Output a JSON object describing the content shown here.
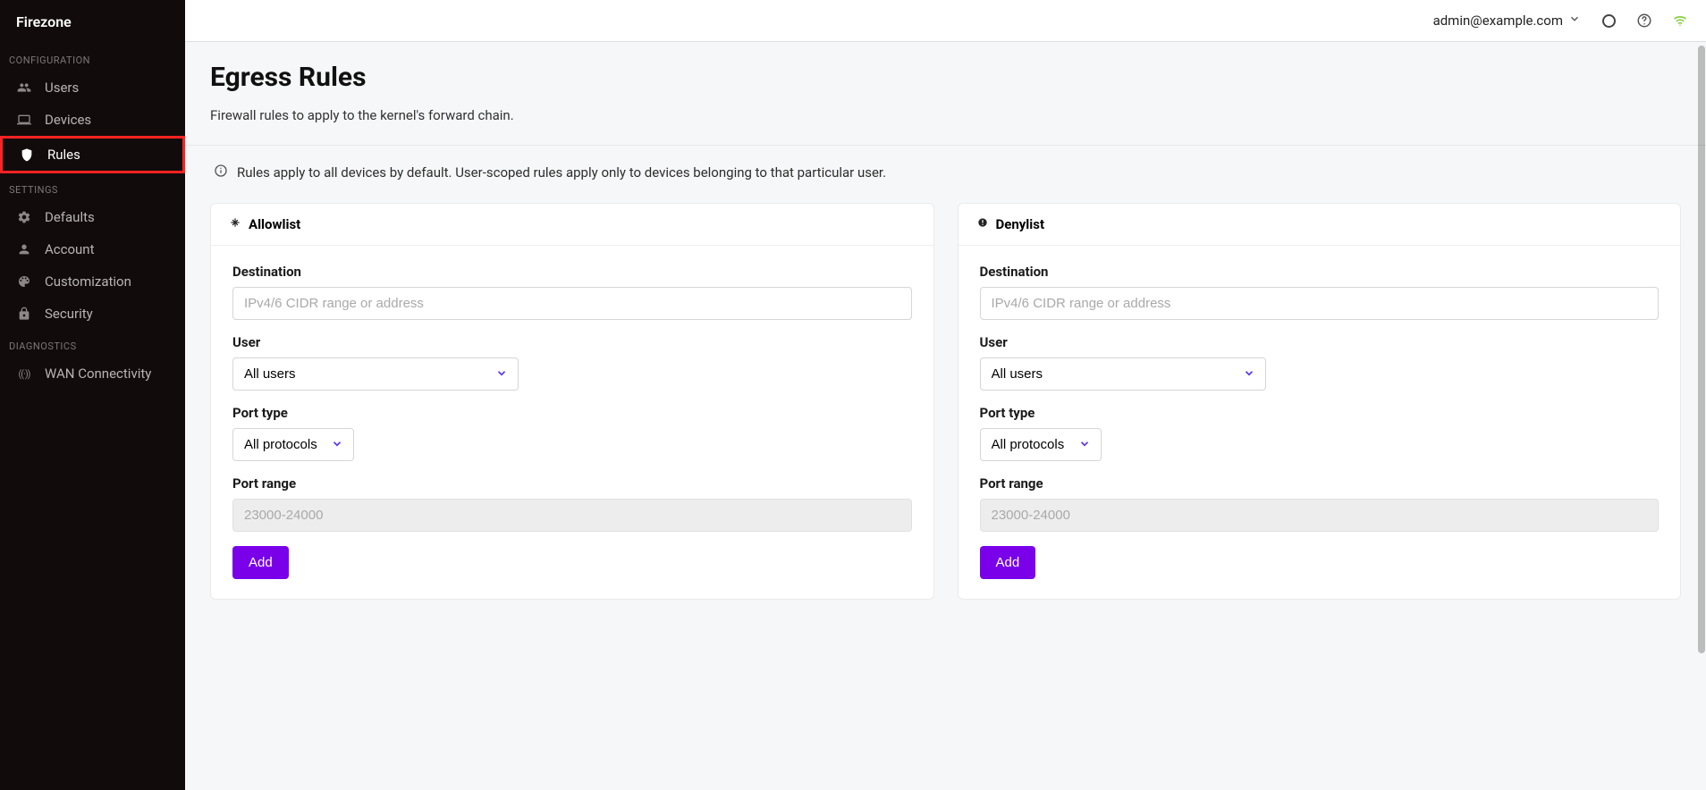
{
  "brand": "Firezone",
  "topbar": {
    "user_email": "admin@example.com"
  },
  "sidebar": {
    "sections": [
      {
        "header": "CONFIGURATION",
        "items": [
          {
            "icon": "users-icon",
            "glyph": "👥",
            "label": "Users",
            "name": "sidebar-item-users"
          },
          {
            "icon": "devices-icon",
            "glyph": "💻",
            "label": "Devices",
            "name": "sidebar-item-devices"
          },
          {
            "icon": "rules-icon",
            "glyph": "🛡",
            "label": "Rules",
            "name": "sidebar-item-rules",
            "active": true
          }
        ]
      },
      {
        "header": "SETTINGS",
        "items": [
          {
            "icon": "gear-icon",
            "glyph": "⚙",
            "label": "Defaults",
            "name": "sidebar-item-defaults"
          },
          {
            "icon": "account-icon",
            "glyph": "👤",
            "label": "Account",
            "name": "sidebar-item-account"
          },
          {
            "icon": "customization-icon",
            "glyph": "🎨",
            "label": "Customization",
            "name": "sidebar-item-customization"
          },
          {
            "icon": "security-icon",
            "glyph": "🔒",
            "label": "Security",
            "name": "sidebar-item-security"
          }
        ]
      },
      {
        "header": "DIAGNOSTICS",
        "items": [
          {
            "icon": "wan-icon",
            "glyph": "((·))",
            "label": "WAN Connectivity",
            "name": "sidebar-item-wan"
          }
        ]
      }
    ]
  },
  "page": {
    "title": "Egress Rules",
    "description": "Firewall rules to apply to the kernel's forward chain.",
    "info": "Rules apply to all devices by default. User-scoped rules apply only to devices belonging to that particular user."
  },
  "forms": {
    "labels": {
      "destination": "Destination",
      "user": "User",
      "port_type": "Port type",
      "port_range": "Port range"
    },
    "placeholders": {
      "destination": "IPv4/6 CIDR range or address",
      "port_range": "23000-24000"
    },
    "user_select_value": "All users",
    "port_type_value": "All protocols",
    "add_button": "Add"
  },
  "cards": {
    "allowlist_title": "Allowlist",
    "denylist_title": "Denylist"
  }
}
